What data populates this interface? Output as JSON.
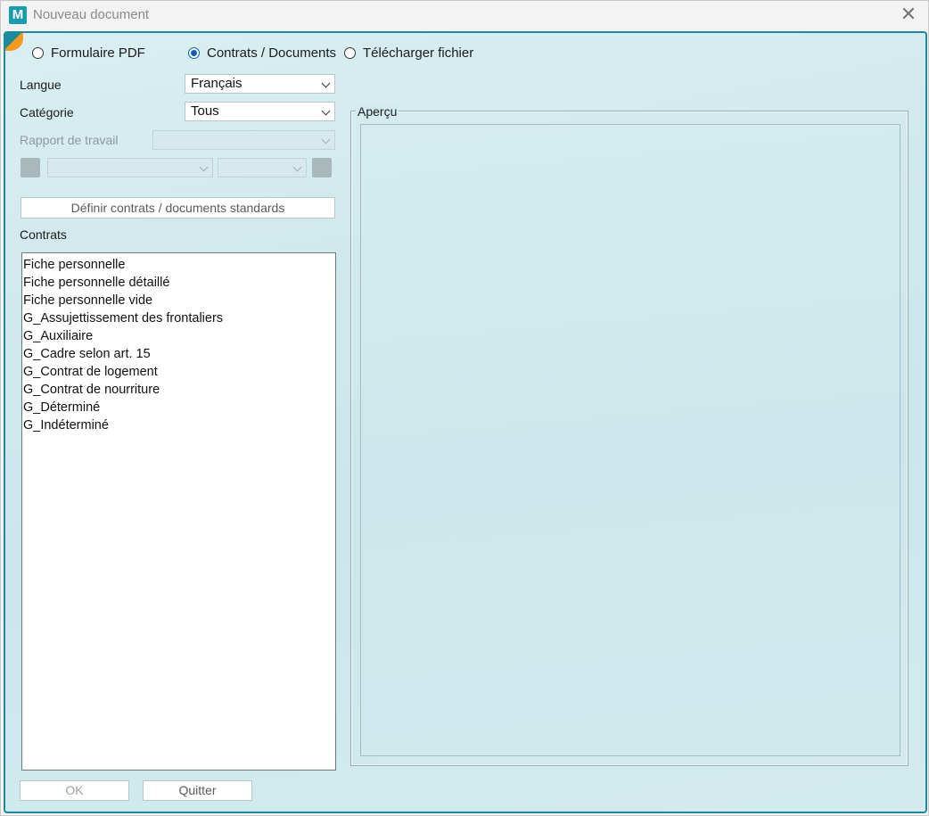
{
  "window": {
    "title": "Nouveau document",
    "app_icon_letter": "M",
    "close_glyph": "✕"
  },
  "mode": {
    "options": [
      {
        "label": "Formulaire PDF",
        "checked": false
      },
      {
        "label": "Contrats / Documents",
        "checked": true
      },
      {
        "label": "Télécharger fichier",
        "checked": false
      }
    ]
  },
  "form": {
    "langue_label": "Langue",
    "langue_value": "Français",
    "categorie_label": "Catégorie",
    "categorie_value": "Tous",
    "rapport_label": "Rapport de travail",
    "rapport_value": "",
    "define_button": "Définir contrats / documents standards"
  },
  "contracts": {
    "label": "Contrats",
    "items": [
      "Fiche personnelle",
      "Fiche personnelle détaillé",
      "Fiche personnelle vide",
      "G_Assujettissement des frontaliers",
      "G_Auxiliaire",
      "G_Cadre selon art. 15",
      "G_Contrat de logement",
      "G_Contrat de nourriture",
      "G_Déterminé",
      "G_Indéterminé"
    ]
  },
  "preview": {
    "title": "Aperçu"
  },
  "footer": {
    "ok_label": "OK",
    "quit_label": "Quitter"
  },
  "colors": {
    "accent": "#1d8a9c",
    "orange_corner": "#f39a1f",
    "radio_selected": "#0a5fb4"
  }
}
